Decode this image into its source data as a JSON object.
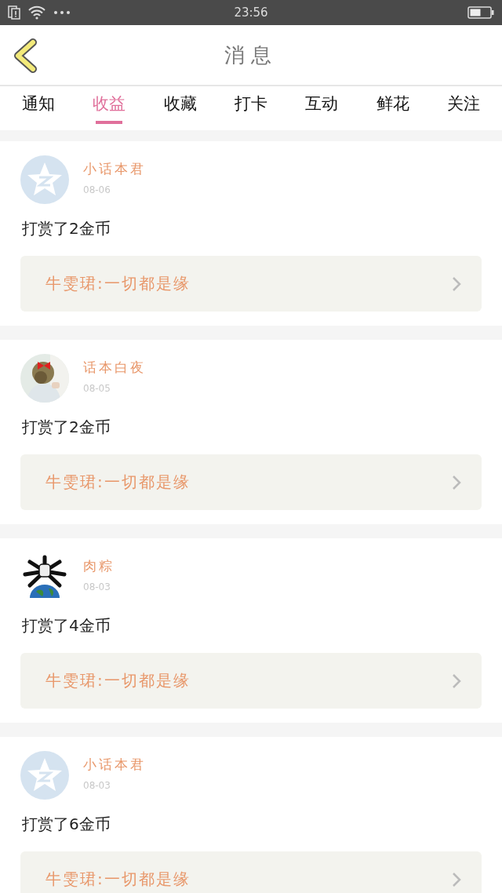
{
  "status_bar": {
    "time": "23:56"
  },
  "header": {
    "title": "消息"
  },
  "tabs": [
    {
      "label": "通知",
      "selected": false
    },
    {
      "label": "收益",
      "selected": true
    },
    {
      "label": "收藏",
      "selected": false
    },
    {
      "label": "打卡",
      "selected": false
    },
    {
      "label": "互动",
      "selected": false
    },
    {
      "label": "鲜花",
      "selected": false
    },
    {
      "label": "关注",
      "selected": false
    }
  ],
  "messages": [
    {
      "kind": "default",
      "name": "小话本君",
      "date": "08-06",
      "text": "打赏了2金币",
      "quote": "牛雯珺:一切都是缘"
    },
    {
      "kind": "picture",
      "name": "话本白夜",
      "date": "08-05",
      "text": "打赏了2金币",
      "quote": "牛雯珺:一切都是缘"
    },
    {
      "kind": "drawing",
      "name": "肉粽",
      "date": "08-03",
      "text": "打赏了4金币",
      "quote": "牛雯珺:一切都是缘"
    },
    {
      "kind": "default",
      "name": "小话本君",
      "date": "08-03",
      "text": "打赏了6金币",
      "quote": "牛雯珺:一切都是缘"
    }
  ]
}
